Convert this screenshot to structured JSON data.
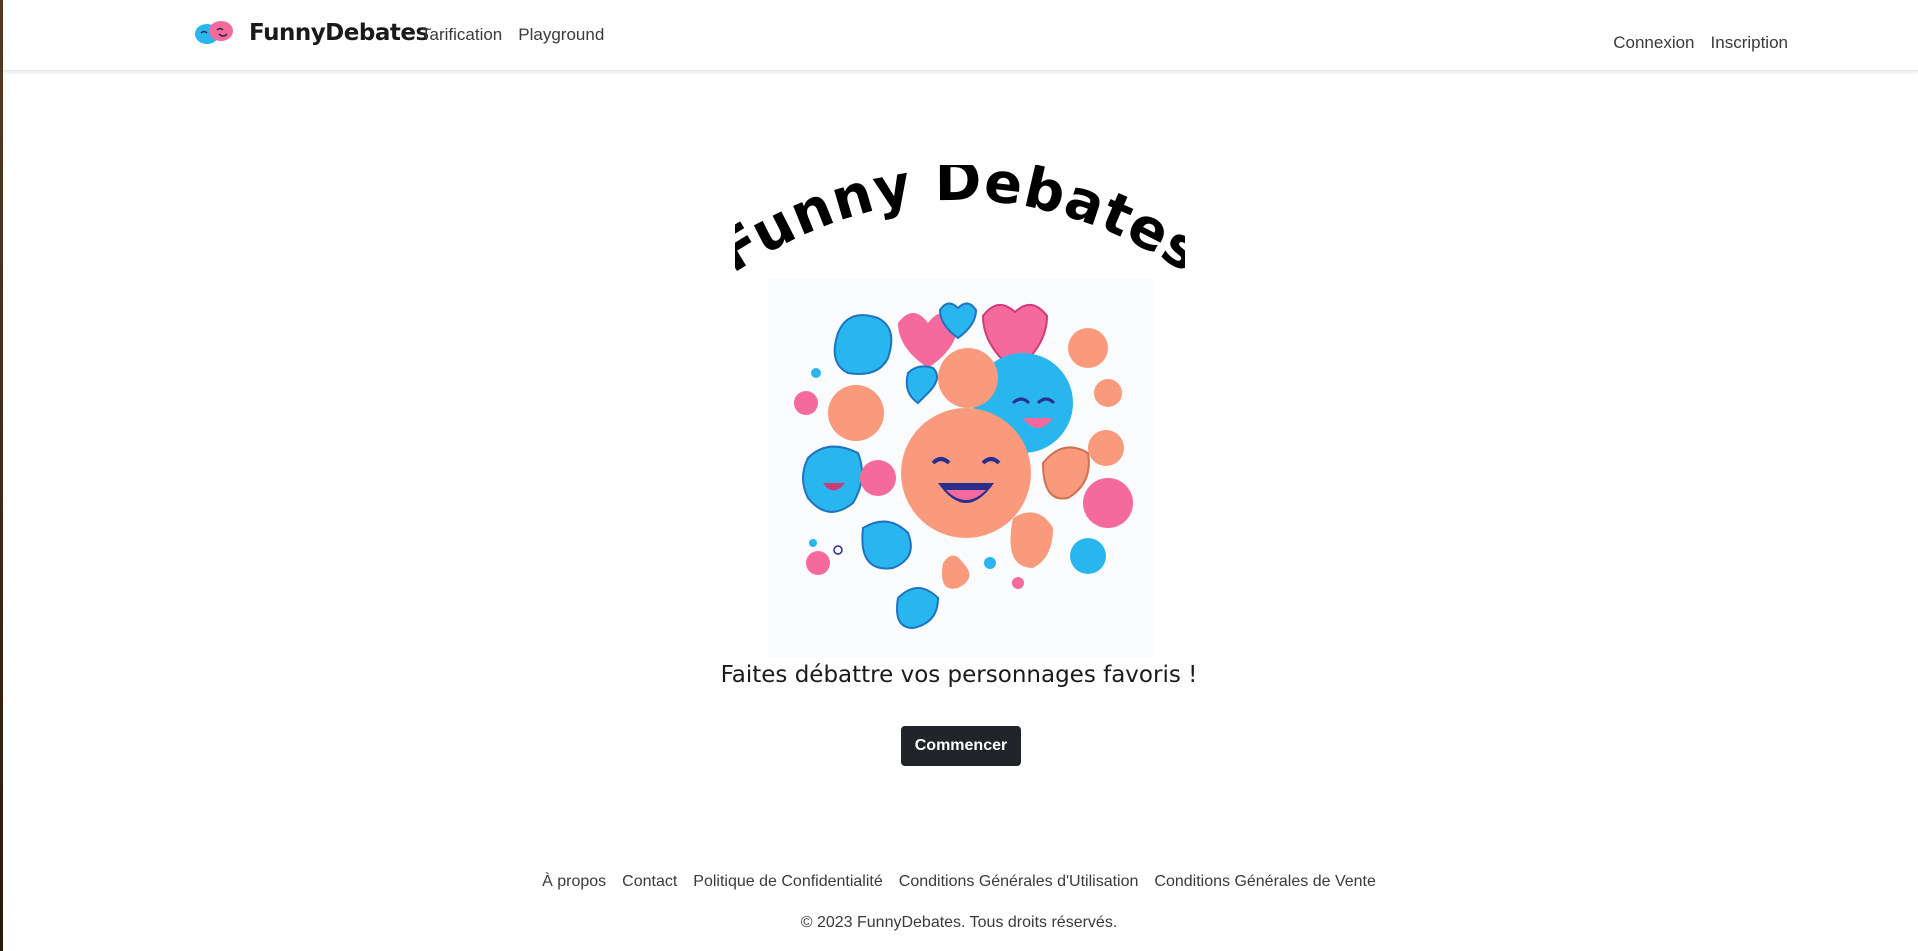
{
  "nav": {
    "brand": "FunnyDebates",
    "left_links": [
      "Tarification",
      "Playground"
    ],
    "right_links": [
      "Connexion",
      "Inscription"
    ]
  },
  "hero": {
    "title": "Funny Debates",
    "tagline": "Faites débattre vos personnages favoris !",
    "cta_label": "Commencer"
  },
  "footer": {
    "links": [
      "À propos",
      "Contact",
      "Politique de Confidentialité",
      "Conditions Générales d'Utilisation",
      "Conditions Générales de Vente"
    ],
    "copyright": "© 2023 FunnyDebates. Tous droits réservés."
  },
  "colors": {
    "blue": "#29b6ee",
    "pink": "#f56a9c",
    "peach": "#f99a7c",
    "dark": "#212529"
  }
}
